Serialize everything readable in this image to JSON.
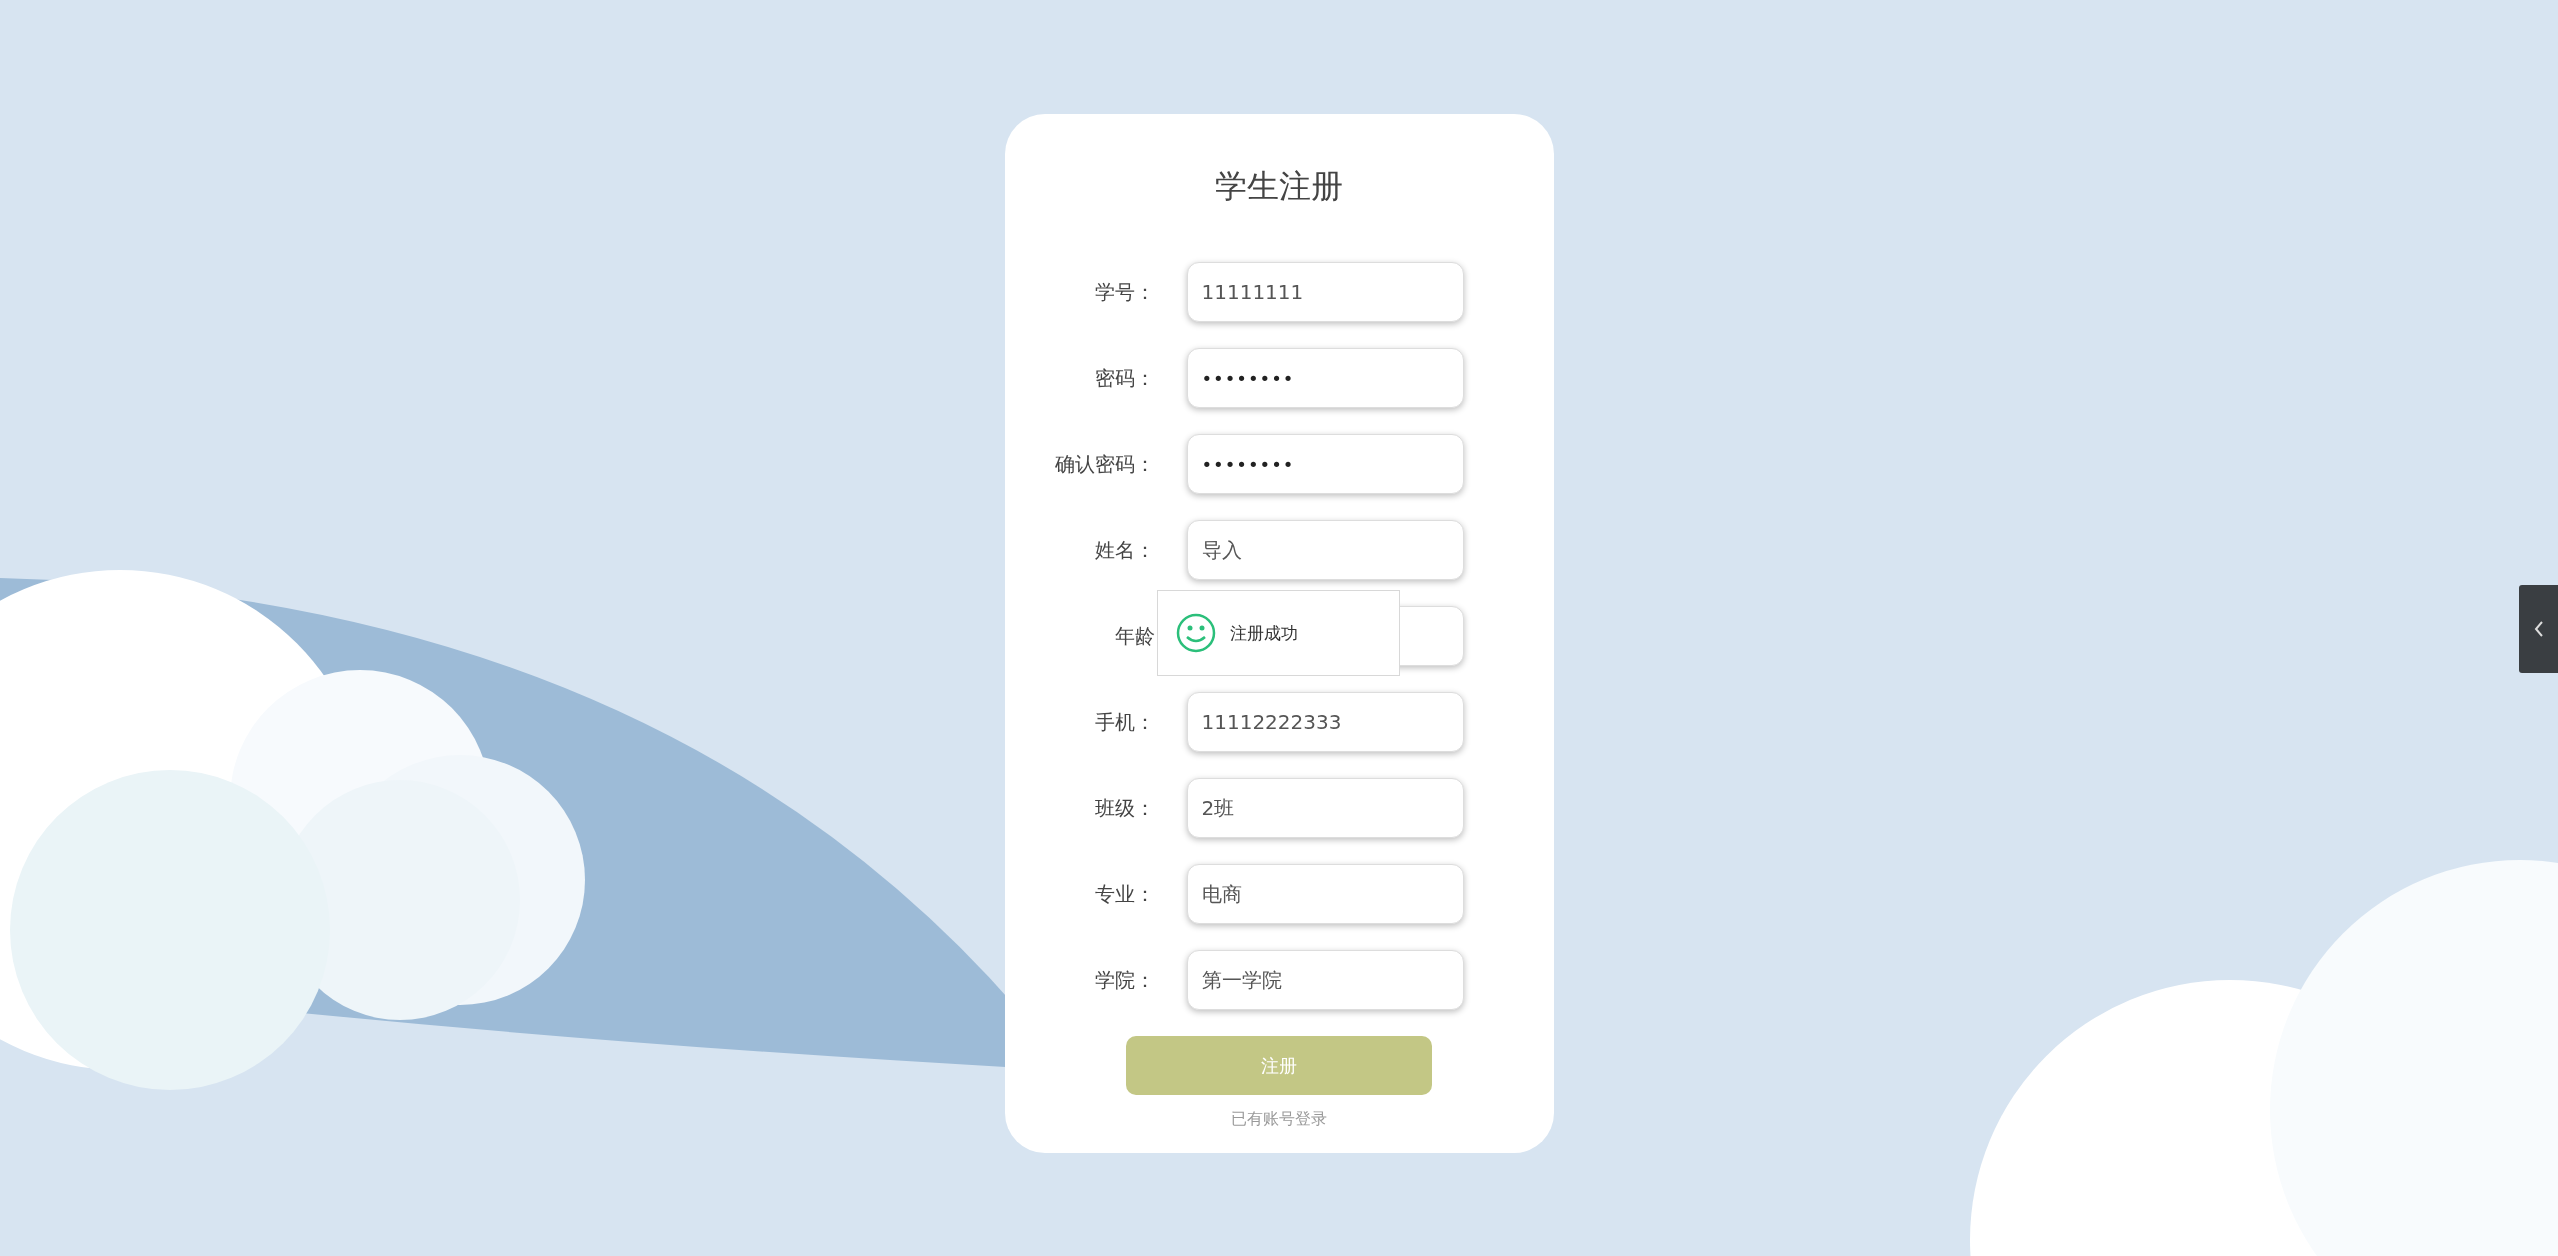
{
  "form": {
    "title": "学生注册",
    "fields": [
      {
        "label": "学号：",
        "kind": "text",
        "value": "11111111"
      },
      {
        "label": "密码：",
        "kind": "password",
        "value": "••••••••"
      },
      {
        "label": "确认密码：",
        "kind": "password",
        "value": "••••••••"
      },
      {
        "label": "姓名：",
        "kind": "text",
        "value": "导入"
      },
      {
        "label": "年龄",
        "kind": "text"
      },
      {
        "label": "手机：",
        "kind": "text",
        "value": "11112222333"
      },
      {
        "label": "班级：",
        "kind": "text",
        "value": "2班"
      },
      {
        "label": "专业：",
        "kind": "text",
        "value": "电商"
      },
      {
        "label": "学院：",
        "kind": "text",
        "value": "第一学院"
      }
    ],
    "submit_button": "注册",
    "login_link": "已有账号登录"
  },
  "toast": {
    "text": "注册成功"
  }
}
